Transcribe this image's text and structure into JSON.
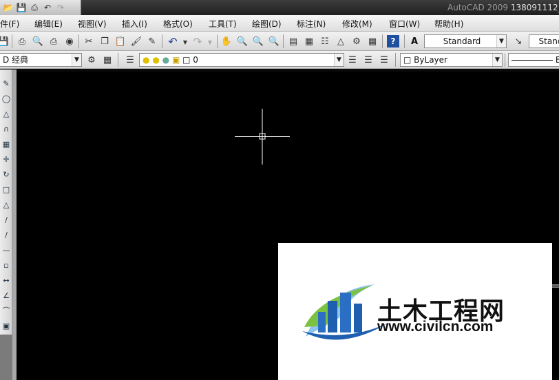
{
  "title_bar": {
    "app": "AutoCAD 2009",
    "document": "138091112_"
  },
  "quick_access": [
    "open-icon",
    "save-icon",
    "print-icon",
    "undo-icon",
    "redo-icon"
  ],
  "menu": {
    "items": [
      {
        "label": "件(F)"
      },
      {
        "label": "编辑(E)"
      },
      {
        "label": "视图(V)"
      },
      {
        "label": "插入(I)"
      },
      {
        "label": "格式(O)"
      },
      {
        "label": "工具(T)"
      },
      {
        "label": "绘图(D)"
      },
      {
        "label": "标注(N)"
      },
      {
        "label": "修改(M)"
      },
      {
        "label": "窗口(W)"
      },
      {
        "label": "帮助(H)"
      }
    ]
  },
  "toolbar": {
    "text_style": "Standard",
    "dim_style": "Stand"
  },
  "layers_bar": {
    "workspace": "D 经典",
    "layer": "0",
    "color": "ByLayer",
    "linetype": "B"
  },
  "watermark": {
    "title": "土木工程网",
    "url": "www.civilcn.com",
    "colors": {
      "blue": "#1f5fb0",
      "green": "#7cc242",
      "light_blue": "#8ec3ea"
    }
  },
  "canvas": {
    "background": "#000000",
    "crosshair_color": "#ffffff"
  }
}
